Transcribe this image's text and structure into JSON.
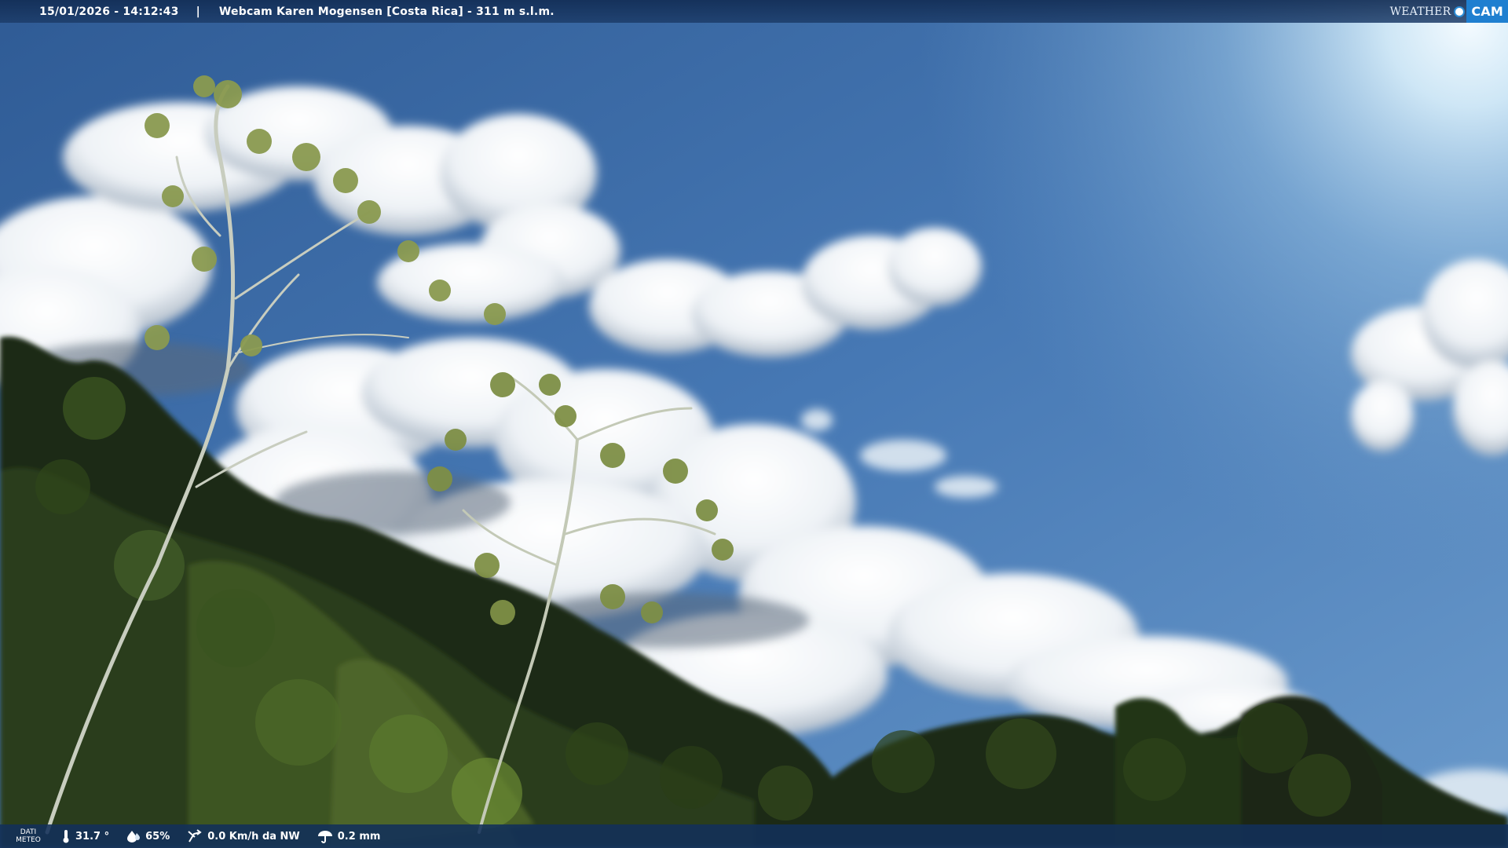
{
  "top_bar": {
    "datetime": "15/01/2026 - 14:12:43",
    "separator": "|",
    "title": "Webcam Karen Mogensen [Costa Rica] - 311 m s.l.m."
  },
  "logo": {
    "weather": "WEATHER",
    "cam": "CAM",
    "accent_color": "#1f7fd0"
  },
  "bottom_bar": {
    "label_line1": "DATI",
    "label_line2": "METEO",
    "temperature": "31.7 °",
    "humidity": "65%",
    "wind": "0.0 Km/h da NW",
    "rain": "0.2 mm"
  },
  "colors": {
    "sky_top": "#3d6aa6",
    "sky_bright": "#cde6f6",
    "foliage_dark": "#1c2b14",
    "foliage_light": "#5f7b2c"
  }
}
